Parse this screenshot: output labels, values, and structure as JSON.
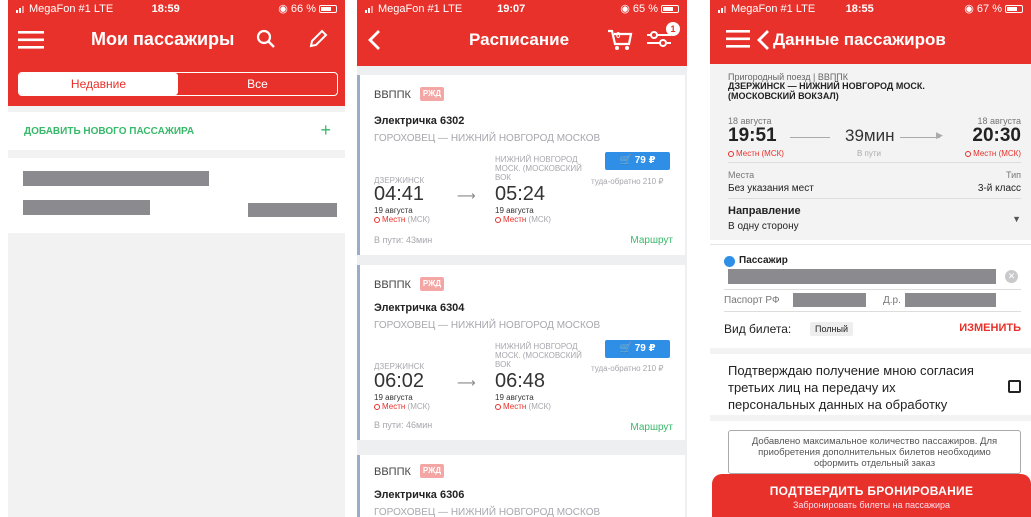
{
  "status": [
    {
      "carrier": "MegaFon #1  LTE",
      "time": "18:59",
      "battery": "66 %"
    },
    {
      "carrier": "MegaFon #1  LTE",
      "time": "19:07",
      "battery": "65 %"
    },
    {
      "carrier": "MegaFon #1  LTE",
      "time": "18:55",
      "battery": "67 %"
    }
  ],
  "screen1": {
    "title": "Мои пассажиры",
    "tabs": {
      "recent": "Недавние",
      "all": "Все"
    },
    "add_label": "ДОБАВИТЬ НОВОГО ПАССАЖИРА",
    "add_icon": "+"
  },
  "screen2": {
    "title": "Расписание",
    "cart_count": "0",
    "filter_badge": "1",
    "cards": [
      {
        "carrier": "ВВППК",
        "logo": "РЖД",
        "train": "Электричка 6302",
        "route": "ГОРОХОВЕЦ — НИЖНИЙ НОВГОРОД МОСКОВ",
        "dep_station": "ДЗЕРЖИНСК",
        "dep_time": "04:41",
        "dep_date": "19 августа",
        "arr_station": "НИЖНИЙ НОВГОРОД МОСК. (МОСКОВСКИЙ ВОК",
        "arr_time": "05:24",
        "arr_date": "19 августа",
        "price": "79 ₽",
        "roundtrip": "туда-обратно 210 ₽",
        "seats": "Местн",
        "tz": "(МСК)",
        "duration": "В пути: 43мин",
        "route_link": "Маршрут"
      },
      {
        "carrier": "ВВППК",
        "logo": "РЖД",
        "train": "Электричка 6304",
        "route": "ГОРОХОВЕЦ — НИЖНИЙ НОВГОРОД МОСКОВ",
        "dep_station": "ДЗЕРЖИНСК",
        "dep_time": "06:02",
        "dep_date": "19 августа",
        "arr_station": "НИЖНИЙ НОВГОРОД МОСК. (МОСКОВСКИЙ ВОК",
        "arr_time": "06:48",
        "arr_date": "19 августа",
        "price": "79 ₽",
        "roundtrip": "туда-обратно 210 ₽",
        "seats": "Местн",
        "tz": "(МСК)",
        "duration": "В пути: 46мин",
        "route_link": "Маршрут"
      },
      {
        "carrier": "ВВППК",
        "logo": "РЖД",
        "train": "Электричка 6306",
        "route": "ГОРОХОВЕЦ — НИЖНИЙ НОВГОРОД МОСКОВ"
      }
    ]
  },
  "screen3": {
    "title": "Данные пассажиров",
    "train_type": "Пригородный поезд | ВВППК",
    "route": "ДЗЕРЖИНСК — НИЖНИЙ НОВГОРОД МОСК. (МОСКОВСКИЙ ВОКЗАЛ)",
    "dep_date": "18 августа",
    "dep_time": "19:51",
    "duration": "39мин",
    "duration_label": "В пути",
    "arr_date": "18 августа",
    "arr_time": "20:30",
    "seats_note": "Местн (МСК)",
    "seats_label": "Места",
    "seats_value": "Без указания мест",
    "type_label": "Тип",
    "type_value": "3-й класс",
    "direction_label": "Направление",
    "direction_value": "В одну сторону",
    "passenger_label": "Пассажир",
    "passport_label": "Паспорт РФ",
    "dob_label": "Д.р.",
    "ticket_label": "Вид билета:",
    "ticket_value": "Полный",
    "change_label": "ИЗМЕНИТЬ",
    "consent_text": "Подтверждаю получение мною согласия третьих лиц на передачу их персональных данных на обработку",
    "notice": "Добавлено максимальное количество пассажиров. Для приобретения дополнительных билетов необходимо оформить отдельный заказ",
    "confirm_label": "ПОДТВЕРДИТЬ БРОНИРОВАНИЕ",
    "confirm_sub": "Забронировать билеты на пассажира"
  }
}
